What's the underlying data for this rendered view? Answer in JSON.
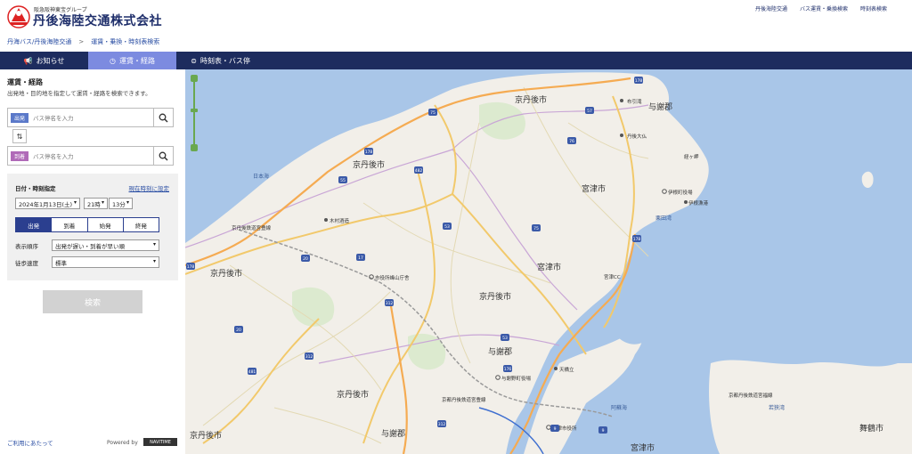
{
  "header": {
    "group_name": "阪急阪神東宝グループ",
    "company_name": "丹後海陸交通株式会社",
    "links": [
      "丹後海陸交通",
      "バス運賃・乗換検索",
      "時刻表検索"
    ]
  },
  "breadcrumb": {
    "items": [
      "丹海バス/丹後海陸交通",
      "運賃・乗換・時刻表検索"
    ],
    "separator": ">"
  },
  "tabs": [
    {
      "label": "お知らせ",
      "icon": "megaphone-icon"
    },
    {
      "label": "運賃・経路",
      "icon": "clock-icon"
    },
    {
      "label": "時刻表・バス停",
      "icon": "bus-icon"
    }
  ],
  "search": {
    "title": "運賃・経路",
    "description": "出発地・目的地を指定して運賃・経路を検索できます。",
    "departure": {
      "badge": "出発",
      "placeholder": "バス停名を入力",
      "color": "#5b79c9"
    },
    "arrival": {
      "badge": "到着",
      "placeholder": "バス停名を入力",
      "color": "#b06ab8"
    }
  },
  "options": {
    "title": "日付・時刻指定",
    "now_link": "現在時刻に設定",
    "date": "2024年1月13日(土)",
    "hour": "21時",
    "minute": "13分",
    "modes": [
      "出発",
      "到着",
      "始発",
      "終発"
    ],
    "active_mode": "出発",
    "order_label": "表示順序",
    "order_value": "出発が遅い・到着が早い順",
    "speed_label": "徒歩速度",
    "speed_value": "標準"
  },
  "search_button": "検索",
  "footer": {
    "usage_link": "ご利用にあたって",
    "powered_by": "Powered by",
    "navitime": "NAVITIME"
  },
  "map": {
    "labels": [
      "京丹後市",
      "京丹後市",
      "京丹後市",
      "京丹後市",
      "京丹後市",
      "京丹後市",
      "与謝郡",
      "与謝郡",
      "与謝郡",
      "宮津市",
      "宮津市",
      "宮津市",
      "舞鶴市",
      "日本海",
      "若狭湾",
      "栗田湾",
      "阿蘇海"
    ],
    "pois": [
      "布引滝",
      "丹後大仏",
      "伊根町役場",
      "伊根漁港",
      "経ヶ岬",
      "市役所峰山庁舎",
      "京丹後鉄道宮豊線",
      "木村酒造",
      "与謝野町役場",
      "天橋立",
      "宮津市役所",
      "京都丹後鉄道宮豊線",
      "京都丹後鉄道宮福線",
      "宮津CC"
    ],
    "routes": [
      "178",
      "178",
      "178",
      "178",
      "57",
      "76",
      "75",
      "482",
      "55",
      "53",
      "53",
      "75",
      "20",
      "17",
      "312",
      "20",
      "312",
      "481",
      "312",
      "9",
      "9",
      "176"
    ]
  },
  "colors": {
    "tabbar": "#1d2c5e",
    "tab_active": "#7c8be0",
    "sea": "#a9c6e8",
    "land": "#f2efe9"
  }
}
